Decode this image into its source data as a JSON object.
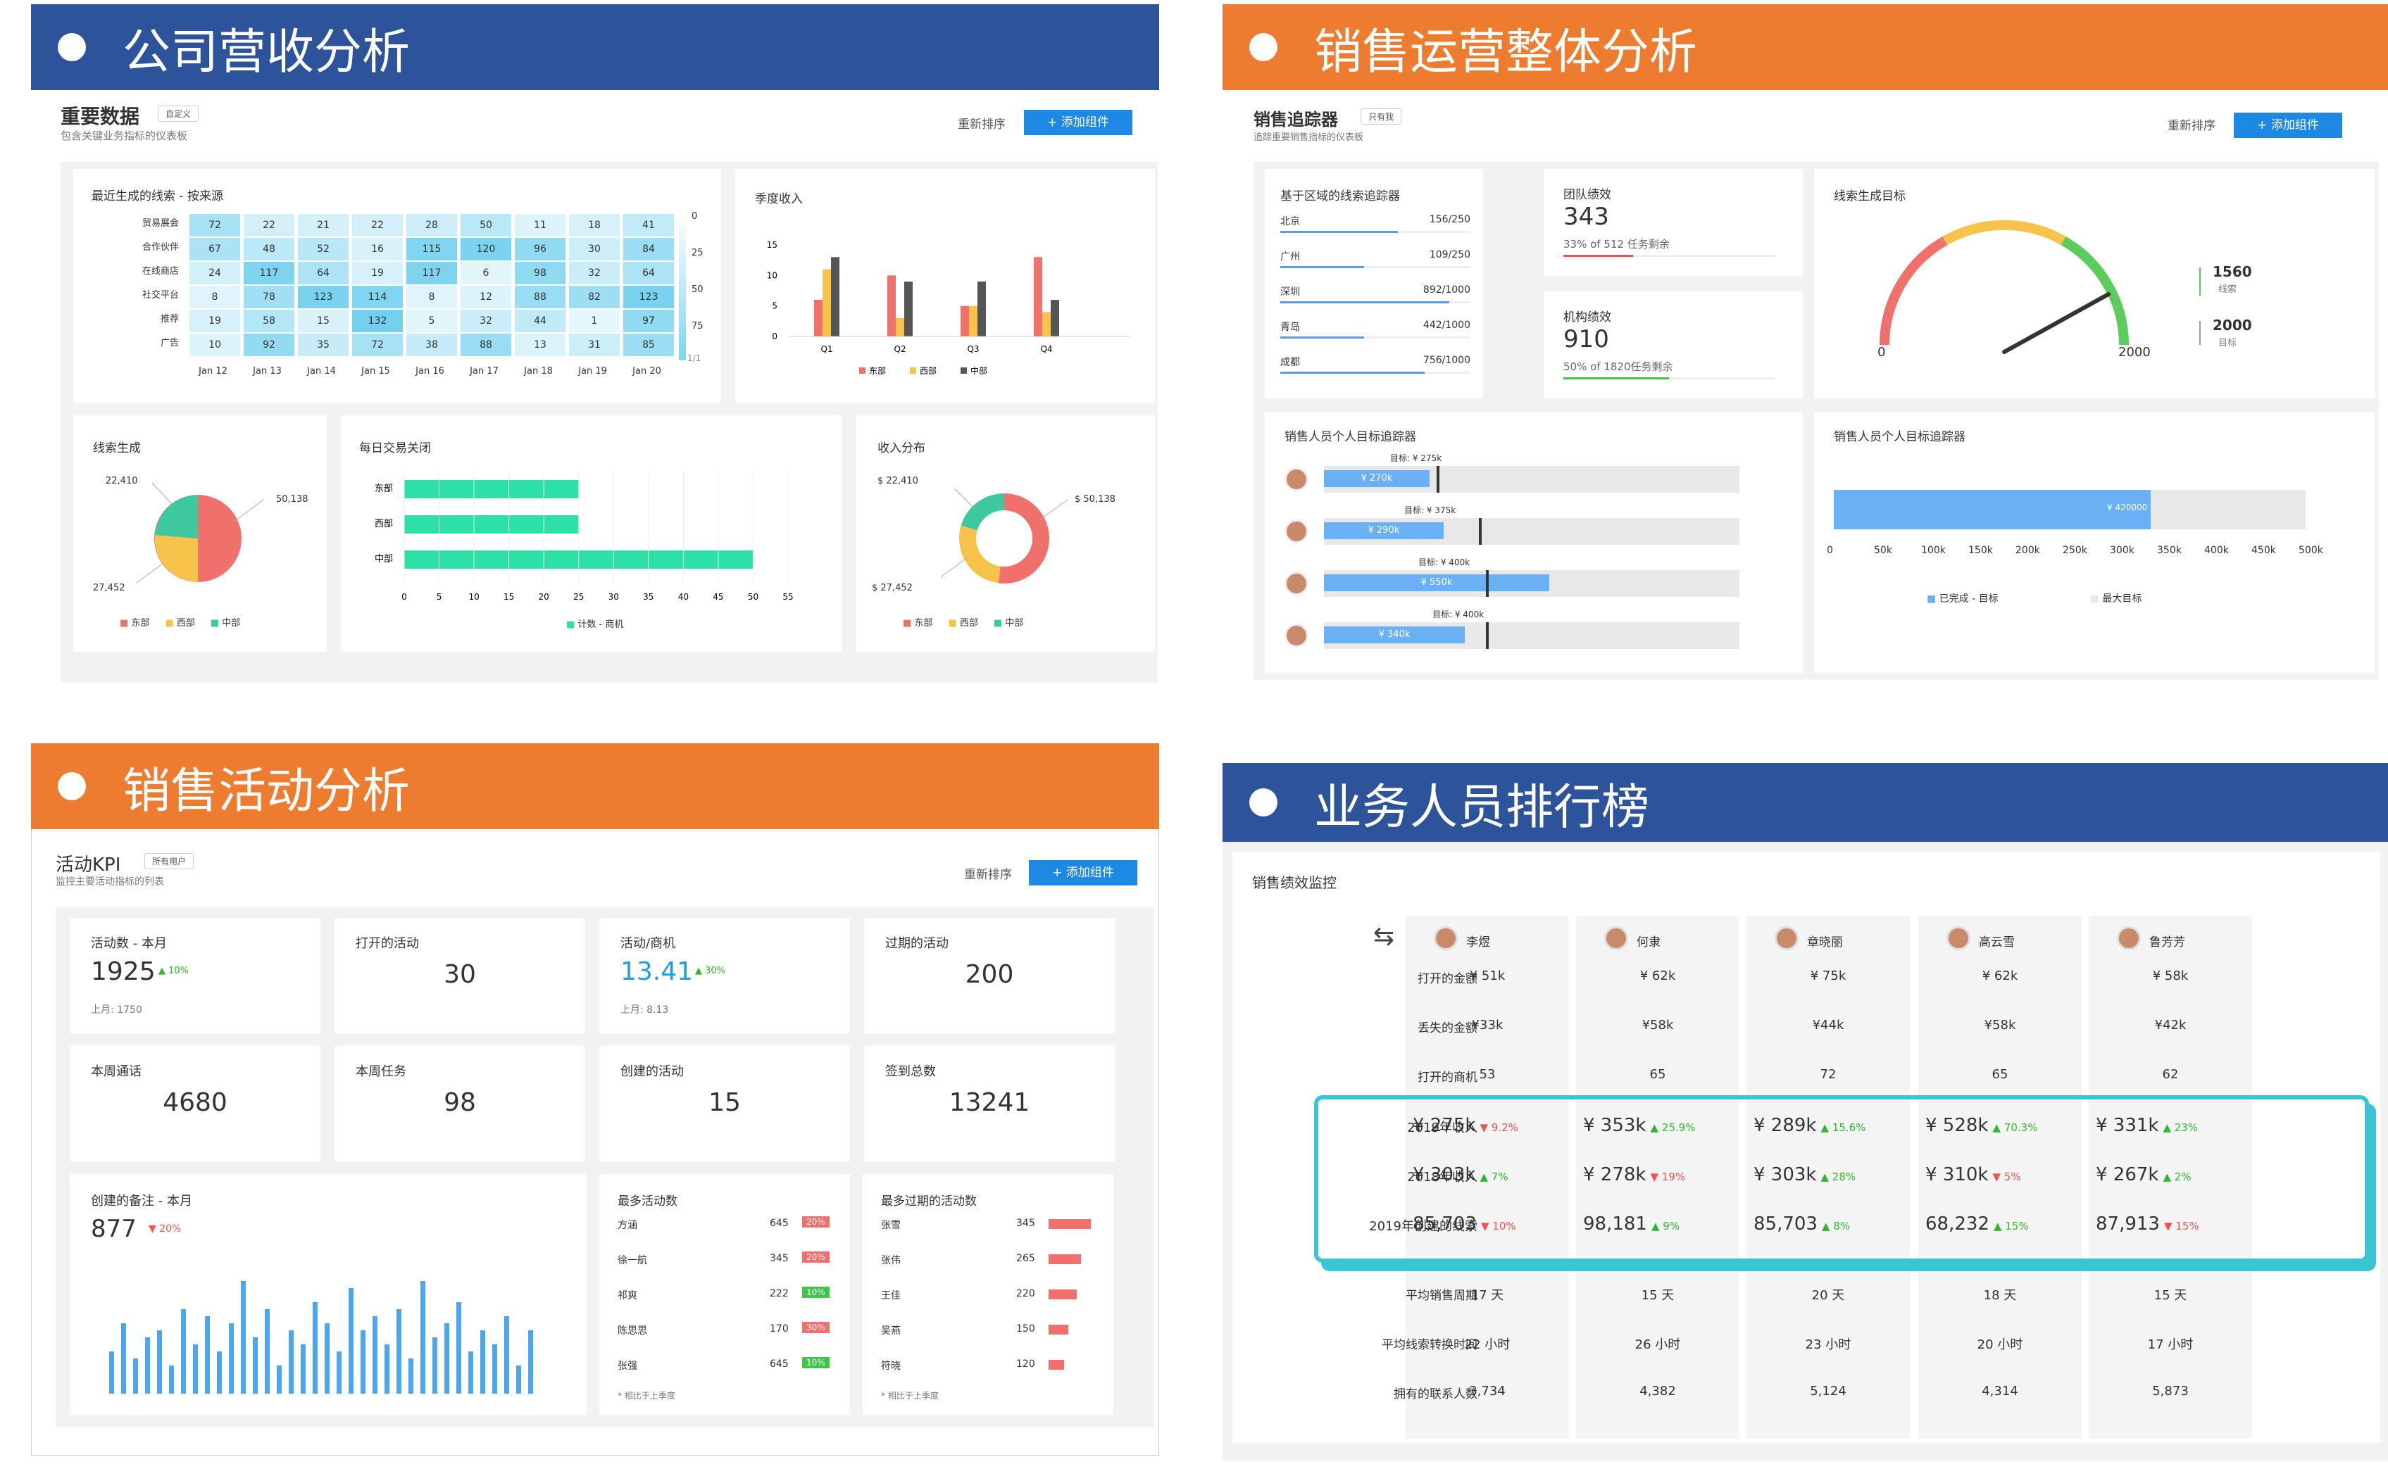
{
  "banners": [
    "公司营收分析",
    "销售运营整体分析",
    "销售活动分析",
    "业务人员排行榜"
  ],
  "revenue": {
    "title": "重要数据",
    "tag": "自定义",
    "subtitle": "包含关键业务指标的仪表板",
    "reorder": "重新排序",
    "add": "+ 添加组件",
    "heat_title": "最近生成的线索 - 按来源",
    "heat_rows": [
      "贸易展会",
      "合作伙伴",
      "在线商店",
      "社交平台",
      "推荐",
      "广告"
    ],
    "heat_cols": [
      "Jan 12",
      "Jan 13",
      "Jan 14",
      "Jan 15",
      "Jan 16",
      "Jan 17",
      "Jan 18",
      "Jan 19",
      "Jan 20"
    ],
    "heat_vals": [
      [
        72,
        22,
        21,
        22,
        28,
        50,
        11,
        18,
        41
      ],
      [
        67,
        48,
        52,
        16,
        115,
        120,
        96,
        30,
        84
      ],
      [
        24,
        117,
        64,
        19,
        117,
        6,
        98,
        32,
        64
      ],
      [
        8,
        78,
        123,
        114,
        8,
        12,
        88,
        82,
        123
      ],
      [
        19,
        58,
        15,
        132,
        5,
        32,
        44,
        1,
        97
      ],
      [
        10,
        92,
        35,
        72,
        38,
        88,
        13,
        31,
        85
      ]
    ],
    "heat_scale": [
      "0",
      "25",
      "50",
      "75"
    ],
    "heat_page": "1/1",
    "quarter_title": "季度收入",
    "quarter_y": [
      "15",
      "10",
      "5",
      "0"
    ],
    "quarter_x": [
      "Q1",
      "Q2",
      "Q3",
      "Q4"
    ],
    "legend3": [
      "东部",
      "西部",
      "中部"
    ],
    "leads_title": "线索生成",
    "leads_labels": [
      "22,410",
      "50,138",
      "27,452"
    ],
    "daily_title": "每日交易关闭",
    "daily_rows": [
      "东部",
      "西部",
      "中部"
    ],
    "daily_x": [
      "0",
      "5",
      "10",
      "15",
      "20",
      "25",
      "30",
      "35",
      "40",
      "45",
      "50",
      "55"
    ],
    "daily_legend": "计数 - 商机",
    "income_title": "收入分布",
    "income_labels": [
      "$ 22,410",
      "$ 50,138",
      "$ 27,452"
    ]
  },
  "ops": {
    "title": "销售追踪器",
    "tag": "只有我",
    "subtitle": "追踪重要销售指标的仪表板",
    "reorder": "重新排序",
    "add": "+ 添加组件",
    "region_title": "基于区域的线索追踪器",
    "regions": [
      {
        "n": "北京",
        "v": "156/250"
      },
      {
        "n": "广州",
        "v": "109/250"
      },
      {
        "n": "深圳",
        "v": "892/1000"
      },
      {
        "n": "青岛",
        "v": "442/1000"
      },
      {
        "n": "成都",
        "v": "756/1000"
      }
    ],
    "team_title": "团队绩效",
    "team_val": "343",
    "team_sub": "33% of 512 任务剩余",
    "org_title": "机构绩效",
    "org_val": "910",
    "org_sub": "50% of 1820任务剩余",
    "goal_title": "线索生成目标",
    "goal_min": "0",
    "goal_max": "2000",
    "goal_v1": "1560",
    "goal_l1": "线索",
    "goal_v2": "2000",
    "goal_l2": "目标",
    "person_title": "销售人员个人目标追踪器",
    "persons": [
      {
        "goal": "目标: ¥ 275k",
        "v": "¥ 270k"
      },
      {
        "goal": "目标: ¥ 375k",
        "v": "¥ 290k"
      },
      {
        "goal": "目标: ¥ 400k",
        "v": "¥ 550k"
      },
      {
        "goal": "目标: ¥ 400k",
        "v": "¥ 340k"
      }
    ],
    "bar_title": "销售人员个人目标追踪器",
    "bar_val": "¥ 420000",
    "bar_x": [
      "0",
      "50k",
      "100k",
      "150k",
      "200k",
      "250k",
      "300k",
      "350k",
      "400k",
      "450k",
      "500k"
    ],
    "bar_legend": [
      "已完成 - 目标",
      "最大目标"
    ]
  },
  "activity": {
    "title": "活动KPI",
    "tag": "所有用户",
    "subtitle": "监控主要活动指标的列表",
    "reorder": "重新排序",
    "add": "+ 添加组件",
    "kpis": [
      {
        "t": "活动数 - 本月",
        "v": "1925",
        "d": "10%",
        "p": "上月: 1750"
      },
      {
        "t": "打开的活动",
        "v": "30"
      },
      {
        "t": "活动/商机",
        "v": "13.41",
        "d": "30%",
        "p": "上月: 8.13"
      },
      {
        "t": "过期的活动",
        "v": "200"
      },
      {
        "t": "本周通话",
        "v": "4680"
      },
      {
        "t": "本周任务",
        "v": "98"
      },
      {
        "t": "创建的活动",
        "v": "15"
      },
      {
        "t": "签到总数",
        "v": "13241"
      }
    ],
    "notes_title": "创建的备注 - 本月",
    "notes_val": "877",
    "notes_delta": "20%",
    "most_title": "最多活动数",
    "most": [
      {
        "n": "方涵",
        "v": "645",
        "p": "20%"
      },
      {
        "n": "徐一航",
        "v": "345",
        "p": "20%"
      },
      {
        "n": "祁爽",
        "v": "222",
        "p": "10%"
      },
      {
        "n": "陈思思",
        "v": "170",
        "p": "30%"
      },
      {
        "n": "张强",
        "v": "645",
        "p": "10%"
      }
    ],
    "most_note": "相比于上季度",
    "overdue_title": "最多过期的活动数",
    "overdue": [
      {
        "n": "张雪",
        "v": "345"
      },
      {
        "n": "张伟",
        "v": "265"
      },
      {
        "n": "王佳",
        "v": "220"
      },
      {
        "n": "吴燕",
        "v": "150"
      },
      {
        "n": "符晓",
        "v": "120"
      }
    ],
    "overdue_note": "相比于上季度"
  },
  "rank": {
    "title": "销售绩效监控",
    "people": [
      "李煜",
      "何隶",
      "章晓丽",
      "高云雪",
      "鲁芳芳"
    ],
    "rows": [
      {
        "label": "打开的金额",
        "vals": [
          "¥ 51k",
          "¥ 62k",
          "¥ 75k",
          "¥ 62k",
          "¥ 58k"
        ]
      },
      {
        "label": "丢失的金额",
        "vals": [
          "¥33k",
          "¥58k",
          "¥44k",
          "¥58k",
          "¥42k"
        ]
      },
      {
        "label": "打开的商机",
        "vals": [
          "53",
          "65",
          "72",
          "65",
          "62"
        ]
      }
    ],
    "hl": [
      {
        "label": "2019年收入",
        "vals": [
          {
            "v": "¥ 275k",
            "d": "9.2%",
            "u": false
          },
          {
            "v": "¥ 353k",
            "d": "25.9%",
            "u": true
          },
          {
            "v": "¥ 289k",
            "d": "15.6%",
            "u": true
          },
          {
            "v": "¥ 528k",
            "d": "70.3%",
            "u": true
          },
          {
            "v": "¥ 331k",
            "d": "23%",
            "u": true
          }
        ]
      },
      {
        "label": "2018年收入",
        "vals": [
          {
            "v": "¥ 303k",
            "d": "7%",
            "u": true
          },
          {
            "v": "¥ 278k",
            "d": "19%",
            "u": false
          },
          {
            "v": "¥ 303k",
            "d": "28%",
            "u": true
          },
          {
            "v": "¥ 310k",
            "d": "5%",
            "u": false
          },
          {
            "v": "¥ 267k",
            "d": "2%",
            "u": true
          }
        ]
      },
      {
        "label": "2019年创建的线索",
        "vals": [
          {
            "v": "85,703",
            "d": "10%",
            "u": false
          },
          {
            "v": "98,181",
            "d": "9%",
            "u": true
          },
          {
            "v": "85,703",
            "d": "8%",
            "u": true
          },
          {
            "v": "68,232",
            "d": "15%",
            "u": true
          },
          {
            "v": "87,913",
            "d": "15%",
            "u": false
          }
        ]
      }
    ],
    "rows2": [
      {
        "label": "平均销售周期",
        "vals": [
          "17 天",
          "15 天",
          "20 天",
          "18 天",
          "15 天"
        ]
      },
      {
        "label": "平均线索转换时间",
        "vals": [
          "22 小时",
          "26 小时",
          "23 小时",
          "20 小时",
          "17 小时"
        ]
      },
      {
        "label": "拥有的联系人数",
        "vals": [
          "3,734",
          "4,382",
          "5,124",
          "4,314",
          "5,873"
        ]
      }
    ]
  }
}
